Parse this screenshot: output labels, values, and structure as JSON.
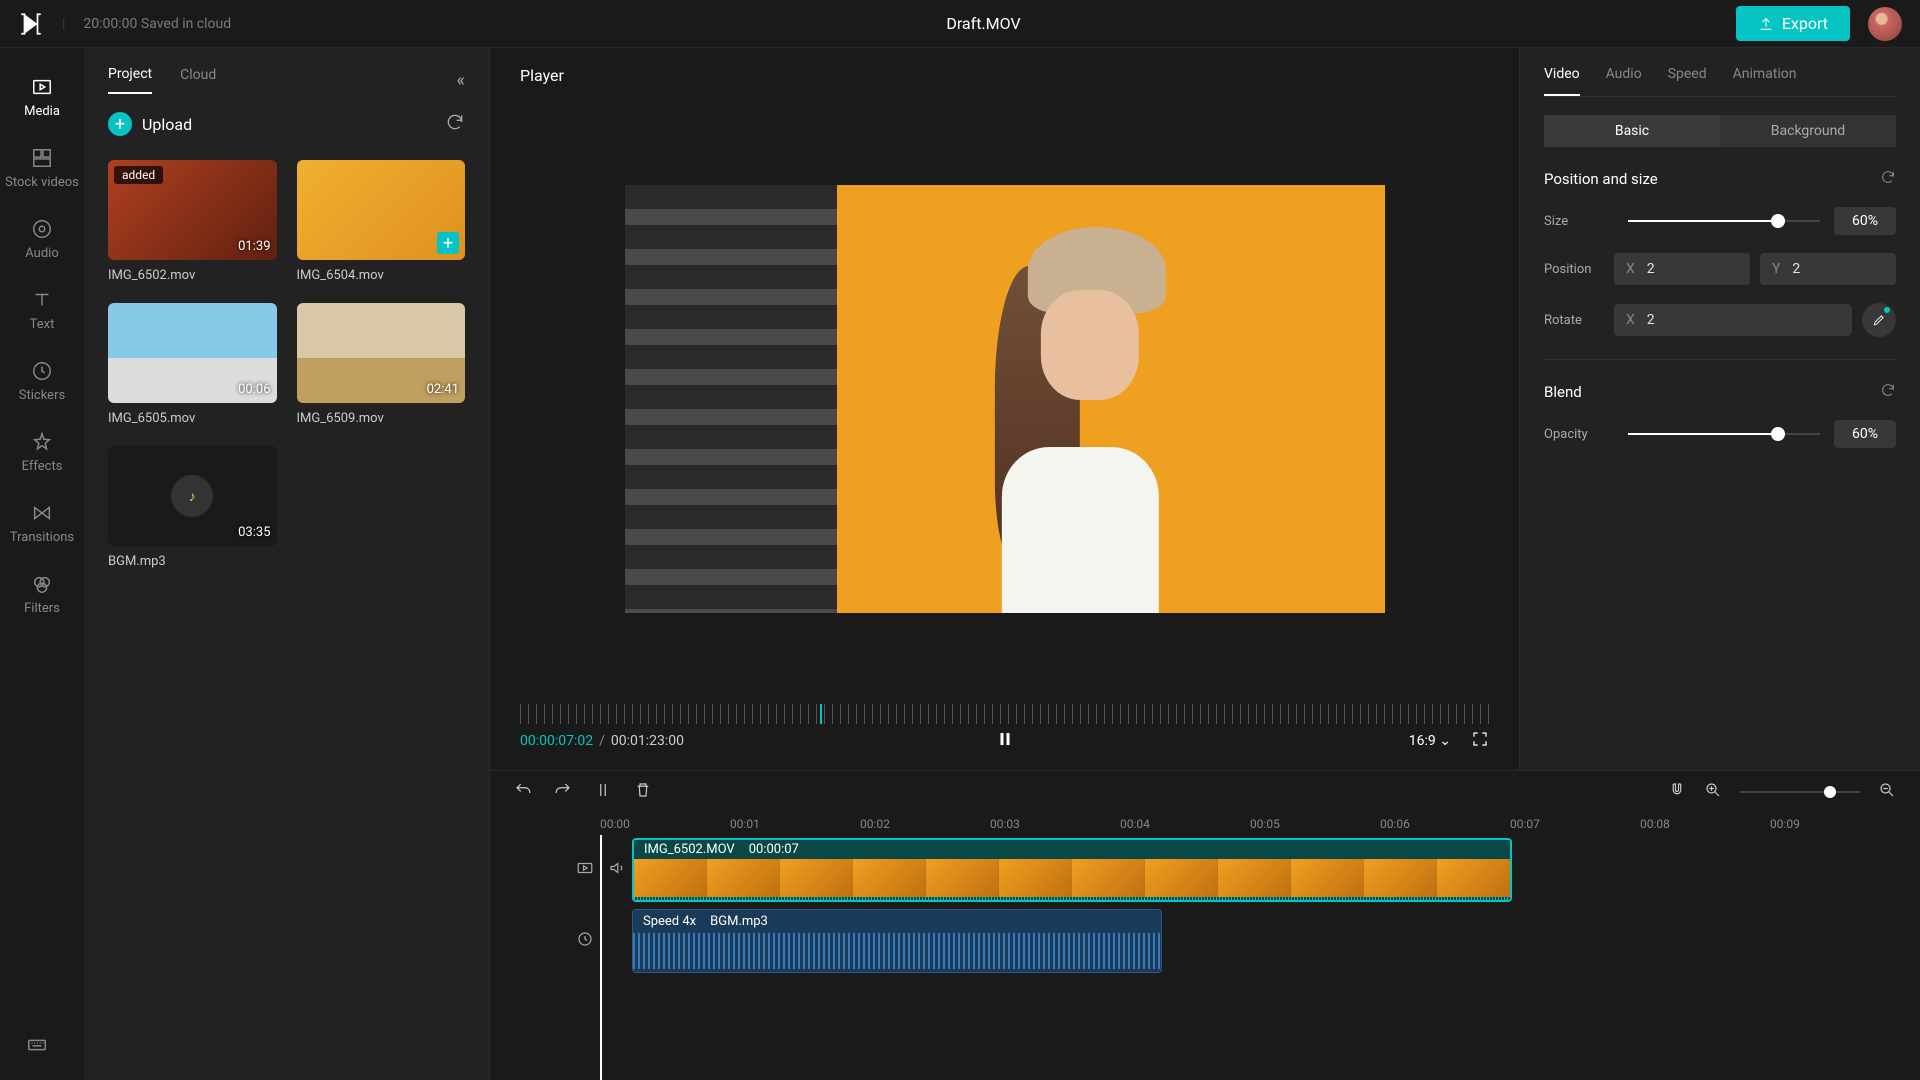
{
  "topbar": {
    "save_status": "20:00:00 Saved in cloud",
    "project_name": "Draft.MOV",
    "export_label": "Export"
  },
  "side_nav": [
    {
      "label": "Media",
      "icon": "media"
    },
    {
      "label": "Stock videos",
      "icon": "stock"
    },
    {
      "label": "Audio",
      "icon": "audio"
    },
    {
      "label": "Text",
      "icon": "text"
    },
    {
      "label": "Stickers",
      "icon": "stickers"
    },
    {
      "label": "Effects",
      "icon": "effects"
    },
    {
      "label": "Transitions",
      "icon": "transitions"
    },
    {
      "label": "Filters",
      "icon": "filters"
    }
  ],
  "project_panel": {
    "tabs": {
      "project": "Project",
      "cloud": "Cloud"
    },
    "upload_label": "Upload",
    "media": [
      {
        "name": "IMG_6502.mov",
        "duration": "01:39",
        "added": "added",
        "thumb": "t1"
      },
      {
        "name": "IMG_6504.mov",
        "duration": "",
        "add_btn": true,
        "thumb": "t2"
      },
      {
        "name": "IMG_6505.mov",
        "duration": "00:06",
        "thumb": "t3"
      },
      {
        "name": "IMG_6509.mov",
        "duration": "02:41",
        "thumb": "t4"
      },
      {
        "name": "BGM.mp3",
        "duration": "03:35",
        "audio": true
      }
    ]
  },
  "player": {
    "title": "Player",
    "current_time": "00:00:07:02",
    "total_time": "00:01:23:00",
    "aspect": "16:9"
  },
  "right_panel": {
    "tabs": [
      "Video",
      "Audio",
      "Speed",
      "Animation"
    ],
    "seg_tabs": [
      "Basic",
      "Background"
    ],
    "sections": {
      "position_size": {
        "title": "Position and size",
        "size_label": "Size",
        "size_value": "60%",
        "position_label": "Position",
        "pos_x": "2",
        "pos_y": "2",
        "rotate_label": "Rotate",
        "rotate_x": "2"
      },
      "blend": {
        "title": "Blend",
        "opacity_label": "Opacity",
        "opacity_value": "60%"
      }
    }
  },
  "timeline": {
    "ruler": [
      "00:00",
      "00:01",
      "00:02",
      "00:03",
      "00:04",
      "00:05",
      "00:06",
      "00:07",
      "00:08",
      "00:09"
    ],
    "video_clip": {
      "name": "IMG_6502.MOV",
      "time": "00:00:07"
    },
    "audio_clip": {
      "speed": "Speed 4x",
      "name": "BGM.mp3"
    }
  },
  "xy": {
    "x": "X",
    "y": "Y"
  }
}
